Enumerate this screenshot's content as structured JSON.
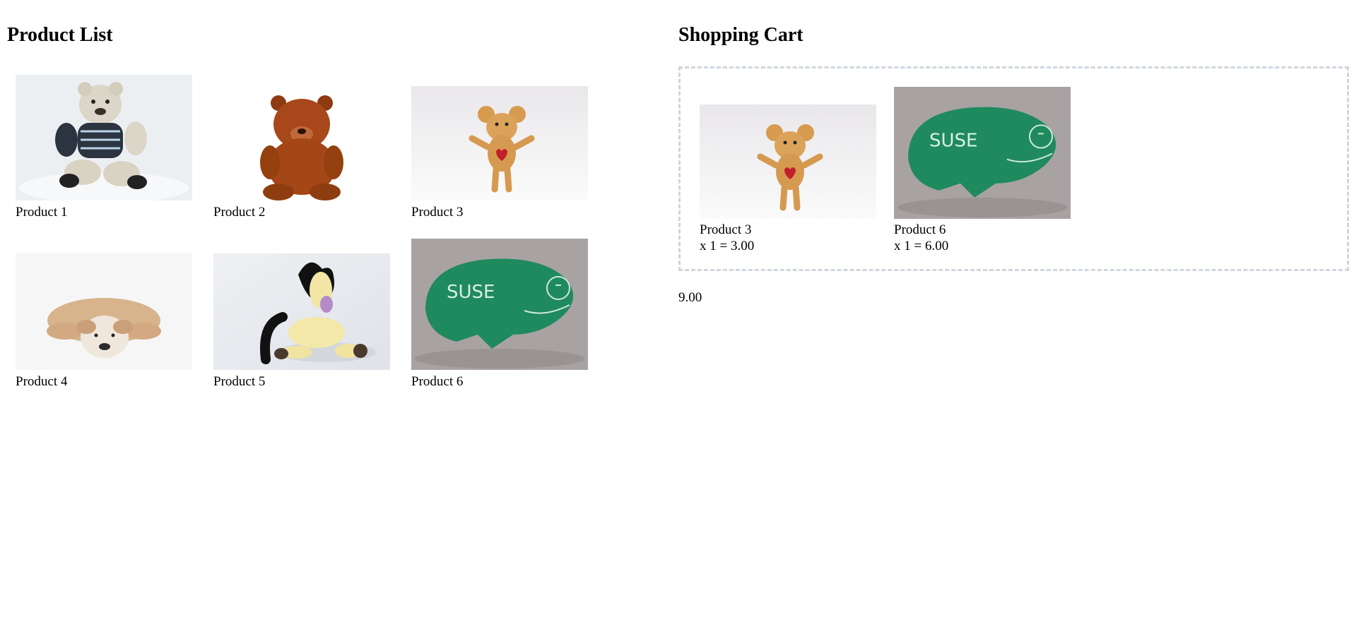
{
  "product_list": {
    "title": "Product List",
    "products": [
      {
        "label": "Product 1",
        "icon": "teddy-bear-sweater-image"
      },
      {
        "label": "Product 2",
        "icon": "brown-bear-plush-image"
      },
      {
        "label": "Product 3",
        "icon": "mouse-plush-heart-image"
      },
      {
        "label": "Product 4",
        "icon": "bulldog-plush-image"
      },
      {
        "label": "Product 5",
        "icon": "horse-plush-image"
      },
      {
        "label": "Product 6",
        "icon": "green-chameleon-plush-image"
      }
    ]
  },
  "shopping_cart": {
    "title": "Shopping Cart",
    "items": [
      {
        "label": "Product 3",
        "line": "x 1 = 3.00"
      },
      {
        "label": "Product 6",
        "line": "x 1 = 6.00"
      }
    ],
    "total": "9.00"
  },
  "chameleon_text": "SUSE",
  "colors": {
    "cart_border": "#cfd6de",
    "chameleon_green": "#1f8a5e"
  }
}
